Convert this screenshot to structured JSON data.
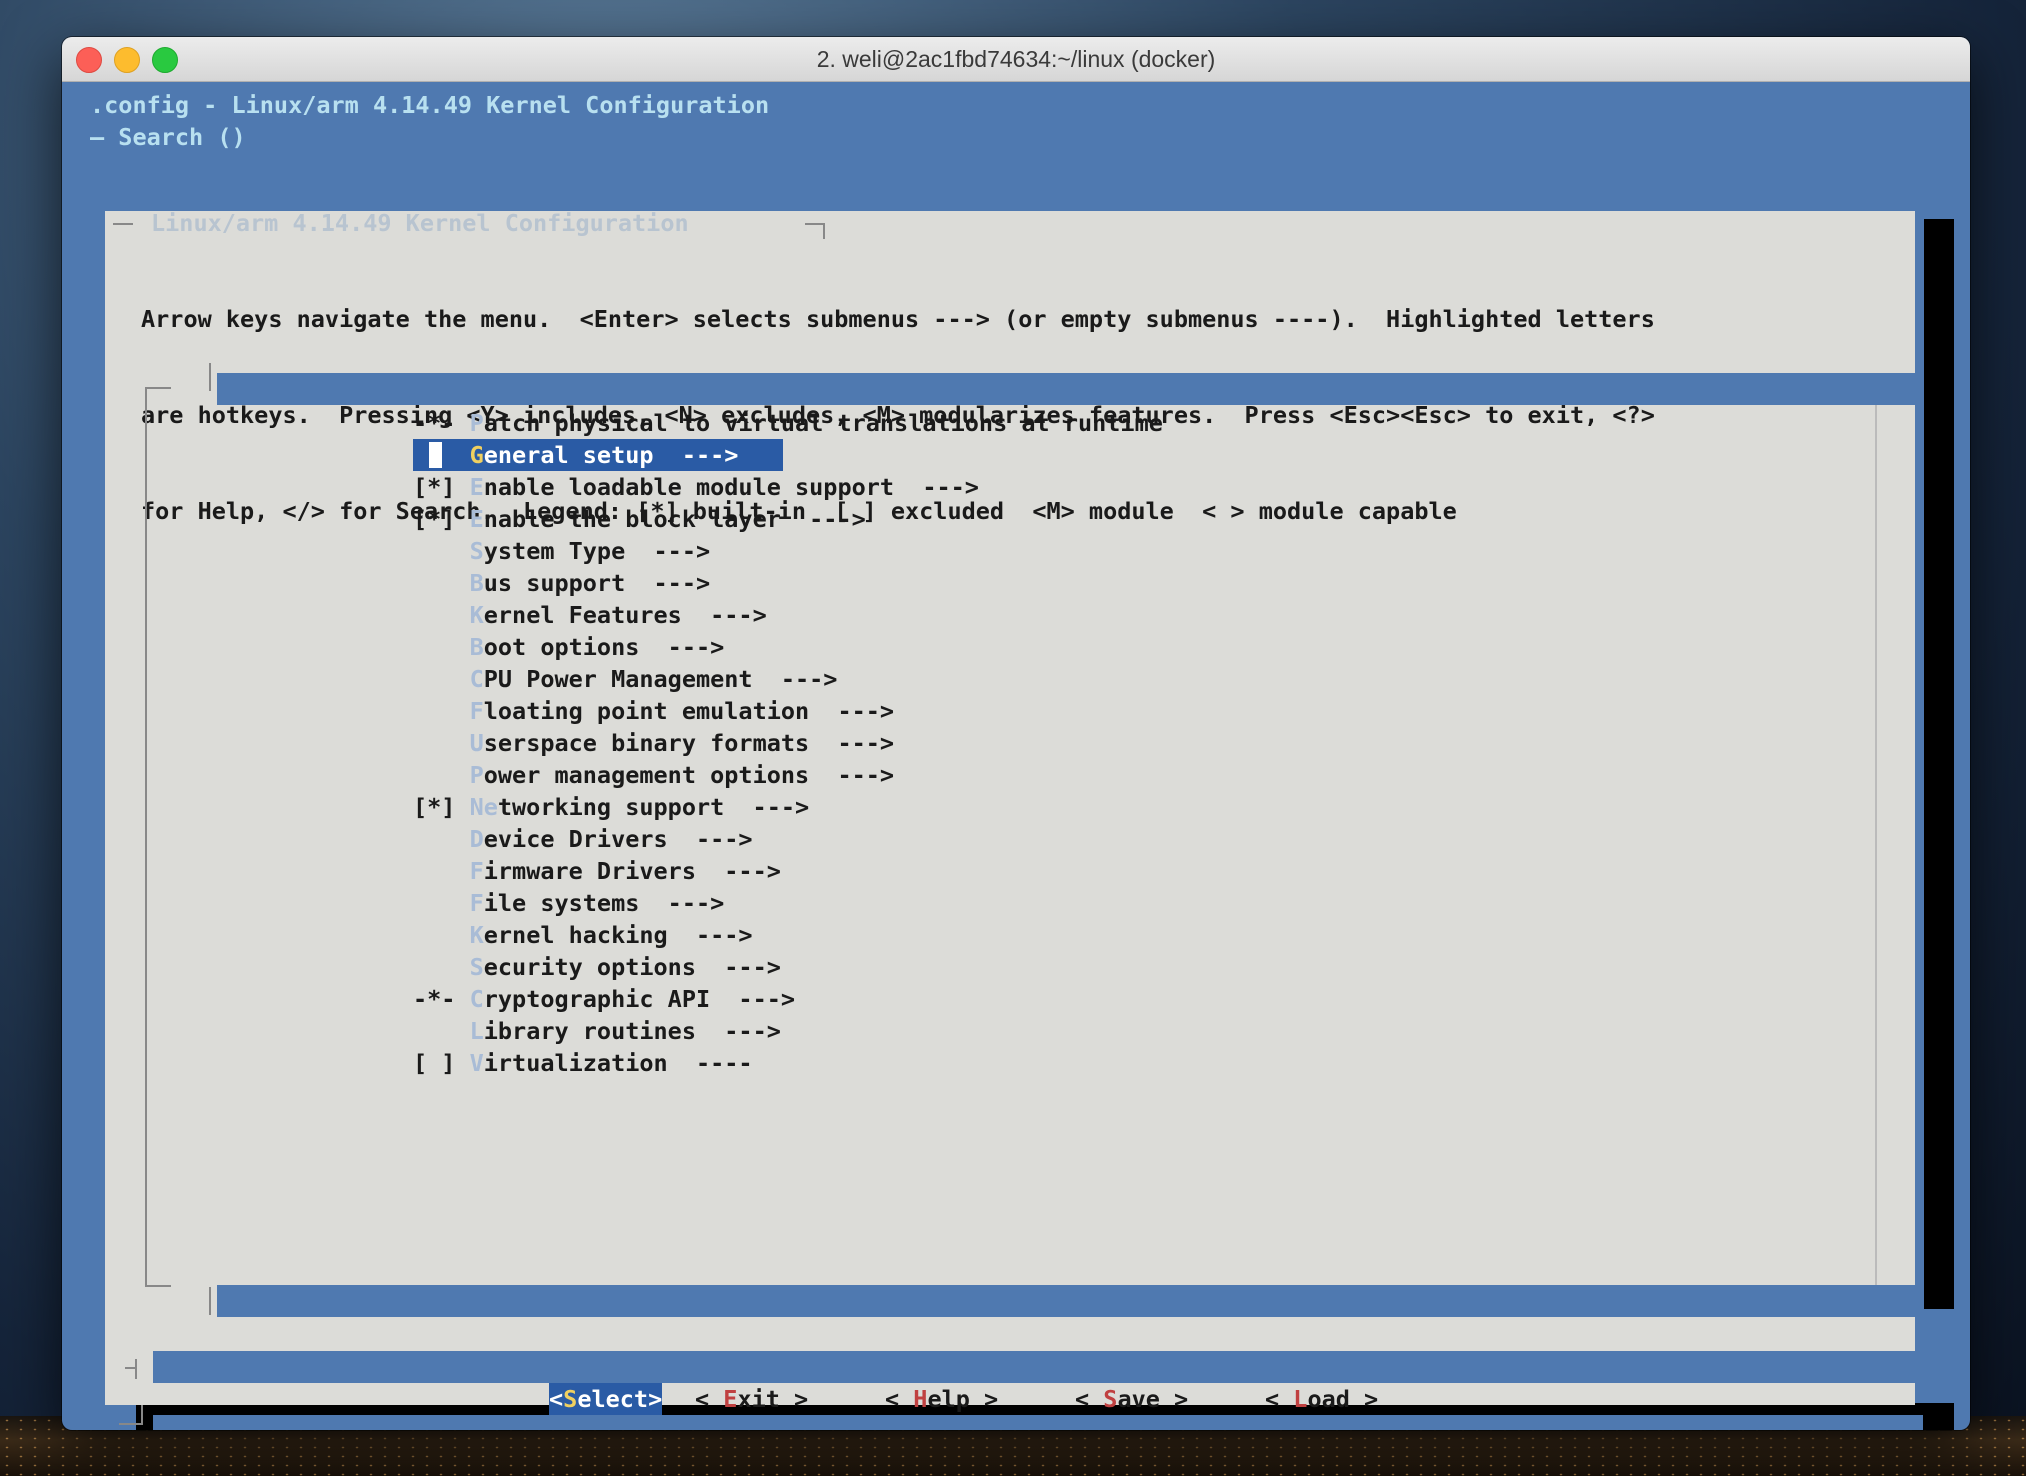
{
  "window": {
    "title": "2. weli@2ac1fbd74634:~/linux (docker)"
  },
  "header": {
    "line1": ".config - Linux/arm 4.14.49 Kernel Configuration",
    "line2": "— Search ()"
  },
  "dialog": {
    "caption": "Linux/arm 4.14.49 Kernel Configuration",
    "description": [
      "Arrow keys navigate the menu.  <Enter> selects submenus ---> (or empty submenus ----).  Highlighted letters",
      "are hotkeys.  Pressing <Y> includes, <N> excludes, <M> modularizes features.  Press <Esc><Esc> to exit, <?>",
      "for Help, </> for Search.  Legend: [*] built-in  [ ] excluded  <M> module  < > module capable"
    ]
  },
  "menu": {
    "items": [
      {
        "prefix": "-*- ",
        "hot": "P",
        "rest": "atch physical to virtual translations at runtime",
        "selected": false
      },
      {
        "prefix": "    ",
        "hot": "G",
        "rest": "eneral setup  --->",
        "selected": true
      },
      {
        "prefix": "[*] ",
        "hot": "E",
        "rest": "nable loadable module support  --->",
        "selected": false
      },
      {
        "prefix": "[*] ",
        "hot": "E",
        "rest": "nable the block layer  --->",
        "selected": false
      },
      {
        "prefix": "    ",
        "hot": "S",
        "rest": "ystem Type  --->",
        "selected": false
      },
      {
        "prefix": "    ",
        "hot": "B",
        "rest": "us support  --->",
        "selected": false
      },
      {
        "prefix": "    ",
        "hot": "K",
        "rest": "ernel Features  --->",
        "selected": false
      },
      {
        "prefix": "    ",
        "hot": "B",
        "rest": "oot options  --->",
        "selected": false
      },
      {
        "prefix": "    ",
        "hot": "C",
        "rest": "PU Power Management  --->",
        "selected": false
      },
      {
        "prefix": "    ",
        "hot": "F",
        "rest": "loating point emulation  --->",
        "selected": false
      },
      {
        "prefix": "    ",
        "hot": "U",
        "rest": "serspace binary formats  --->",
        "selected": false
      },
      {
        "prefix": "    ",
        "hot": "P",
        "rest": "ower management options  --->",
        "selected": false
      },
      {
        "prefix": "[*] ",
        "hot": "Ne",
        "rest": "tworking support  --->",
        "selected": false
      },
      {
        "prefix": "    ",
        "hot": "D",
        "rest": "evice Drivers  --->",
        "selected": false
      },
      {
        "prefix": "    ",
        "hot": "F",
        "rest": "irmware Drivers  --->",
        "selected": false
      },
      {
        "prefix": "    ",
        "hot": "F",
        "rest": "ile systems  --->",
        "selected": false
      },
      {
        "prefix": "    ",
        "hot": "K",
        "rest": "ernel hacking  --->",
        "selected": false
      },
      {
        "prefix": "    ",
        "hot": "S",
        "rest": "ecurity options  --->",
        "selected": false
      },
      {
        "prefix": "-*- ",
        "hot": "C",
        "rest": "ryptographic API  --->",
        "selected": false
      },
      {
        "prefix": "    ",
        "hot": "L",
        "rest": "ibrary routines  --->",
        "selected": false
      },
      {
        "prefix": "[ ] ",
        "hot": "V",
        "rest": "irtualization  ----",
        "selected": false
      }
    ]
  },
  "buttons": [
    {
      "name": "select-button",
      "pre": "<",
      "hot": "S",
      "rest": "elect",
      "post": ">",
      "selected": true
    },
    {
      "name": "exit-button",
      "pre": "< ",
      "hot": "E",
      "rest": "xit",
      "post": " >",
      "selected": false
    },
    {
      "name": "help-button",
      "pre": "< ",
      "hot": "H",
      "rest": "elp",
      "post": " >",
      "selected": false
    },
    {
      "name": "save-button",
      "pre": "< ",
      "hot": "S",
      "rest": "ave",
      "post": " >",
      "selected": false
    },
    {
      "name": "load-button",
      "pre": "< ",
      "hot": "L",
      "rest": "oad",
      "post": " >",
      "selected": false
    }
  ]
}
